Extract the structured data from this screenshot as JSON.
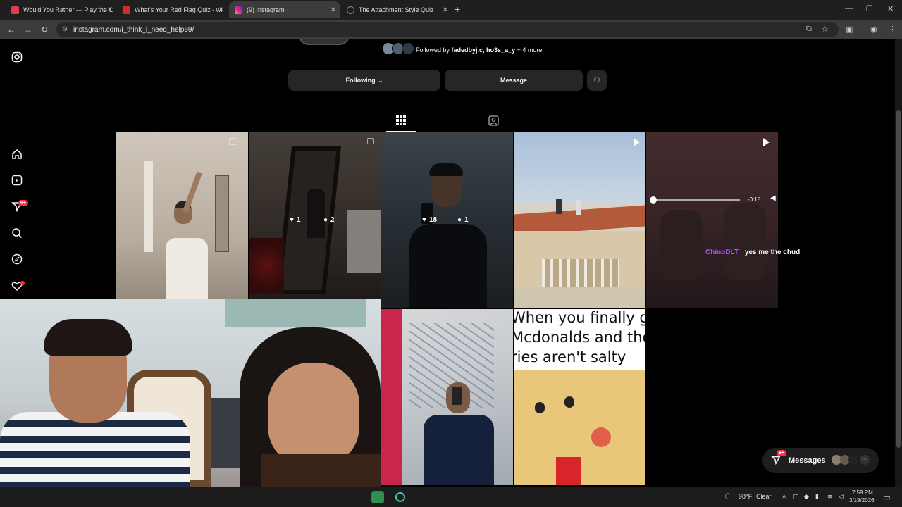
{
  "browser": {
    "tabs": [
      {
        "title": "Would You Rather — Play the C",
        "active": false,
        "favicon_color": "#e23b4e"
      },
      {
        "title": "What's Your Red Flag Quiz - wi",
        "active": false,
        "favicon_color": "#d92a2a"
      },
      {
        "title": "(9) Instagram",
        "active": true,
        "favicon_color": "#d6249f"
      },
      {
        "title": "The Attachment Style Quiz",
        "active": false,
        "favicon_color": "#888888"
      }
    ],
    "url": "instagram.com/i_think_i_need_help69/"
  },
  "sidebar": {
    "notifications_badge": "9+"
  },
  "profile": {
    "followed_by_prefix": "Followed by",
    "followed_by_names": "fadedbyj.c, ho3s_a_y",
    "followed_by_more": "+ 4 more",
    "following_button": "Following",
    "message_button": "Message"
  },
  "grid": {
    "posts": [
      {
        "likes": "",
        "comments": ""
      },
      {
        "likes": "1",
        "comments": "2"
      },
      {
        "likes": "18",
        "comments": "1"
      }
    ],
    "reel_overlay": {
      "time": "-0:18",
      "chat_user": "ChinoDLT",
      "chat_text": "yes me the chud"
    },
    "meme_text": "When you finally get\nMcdonalds and the\nries aren't salty"
  },
  "messages_bar": {
    "label": "Messages",
    "badge": "9+"
  },
  "taskbar": {
    "weather_temp": "98°F",
    "weather_desc": "Clear",
    "time": "7:59 PM",
    "date": "3/19/2026"
  },
  "colors": {
    "page_bg": "#000000",
    "button_bg": "#262626",
    "notification_red": "#ff3040",
    "chat_user_purple": "#b04cff"
  }
}
